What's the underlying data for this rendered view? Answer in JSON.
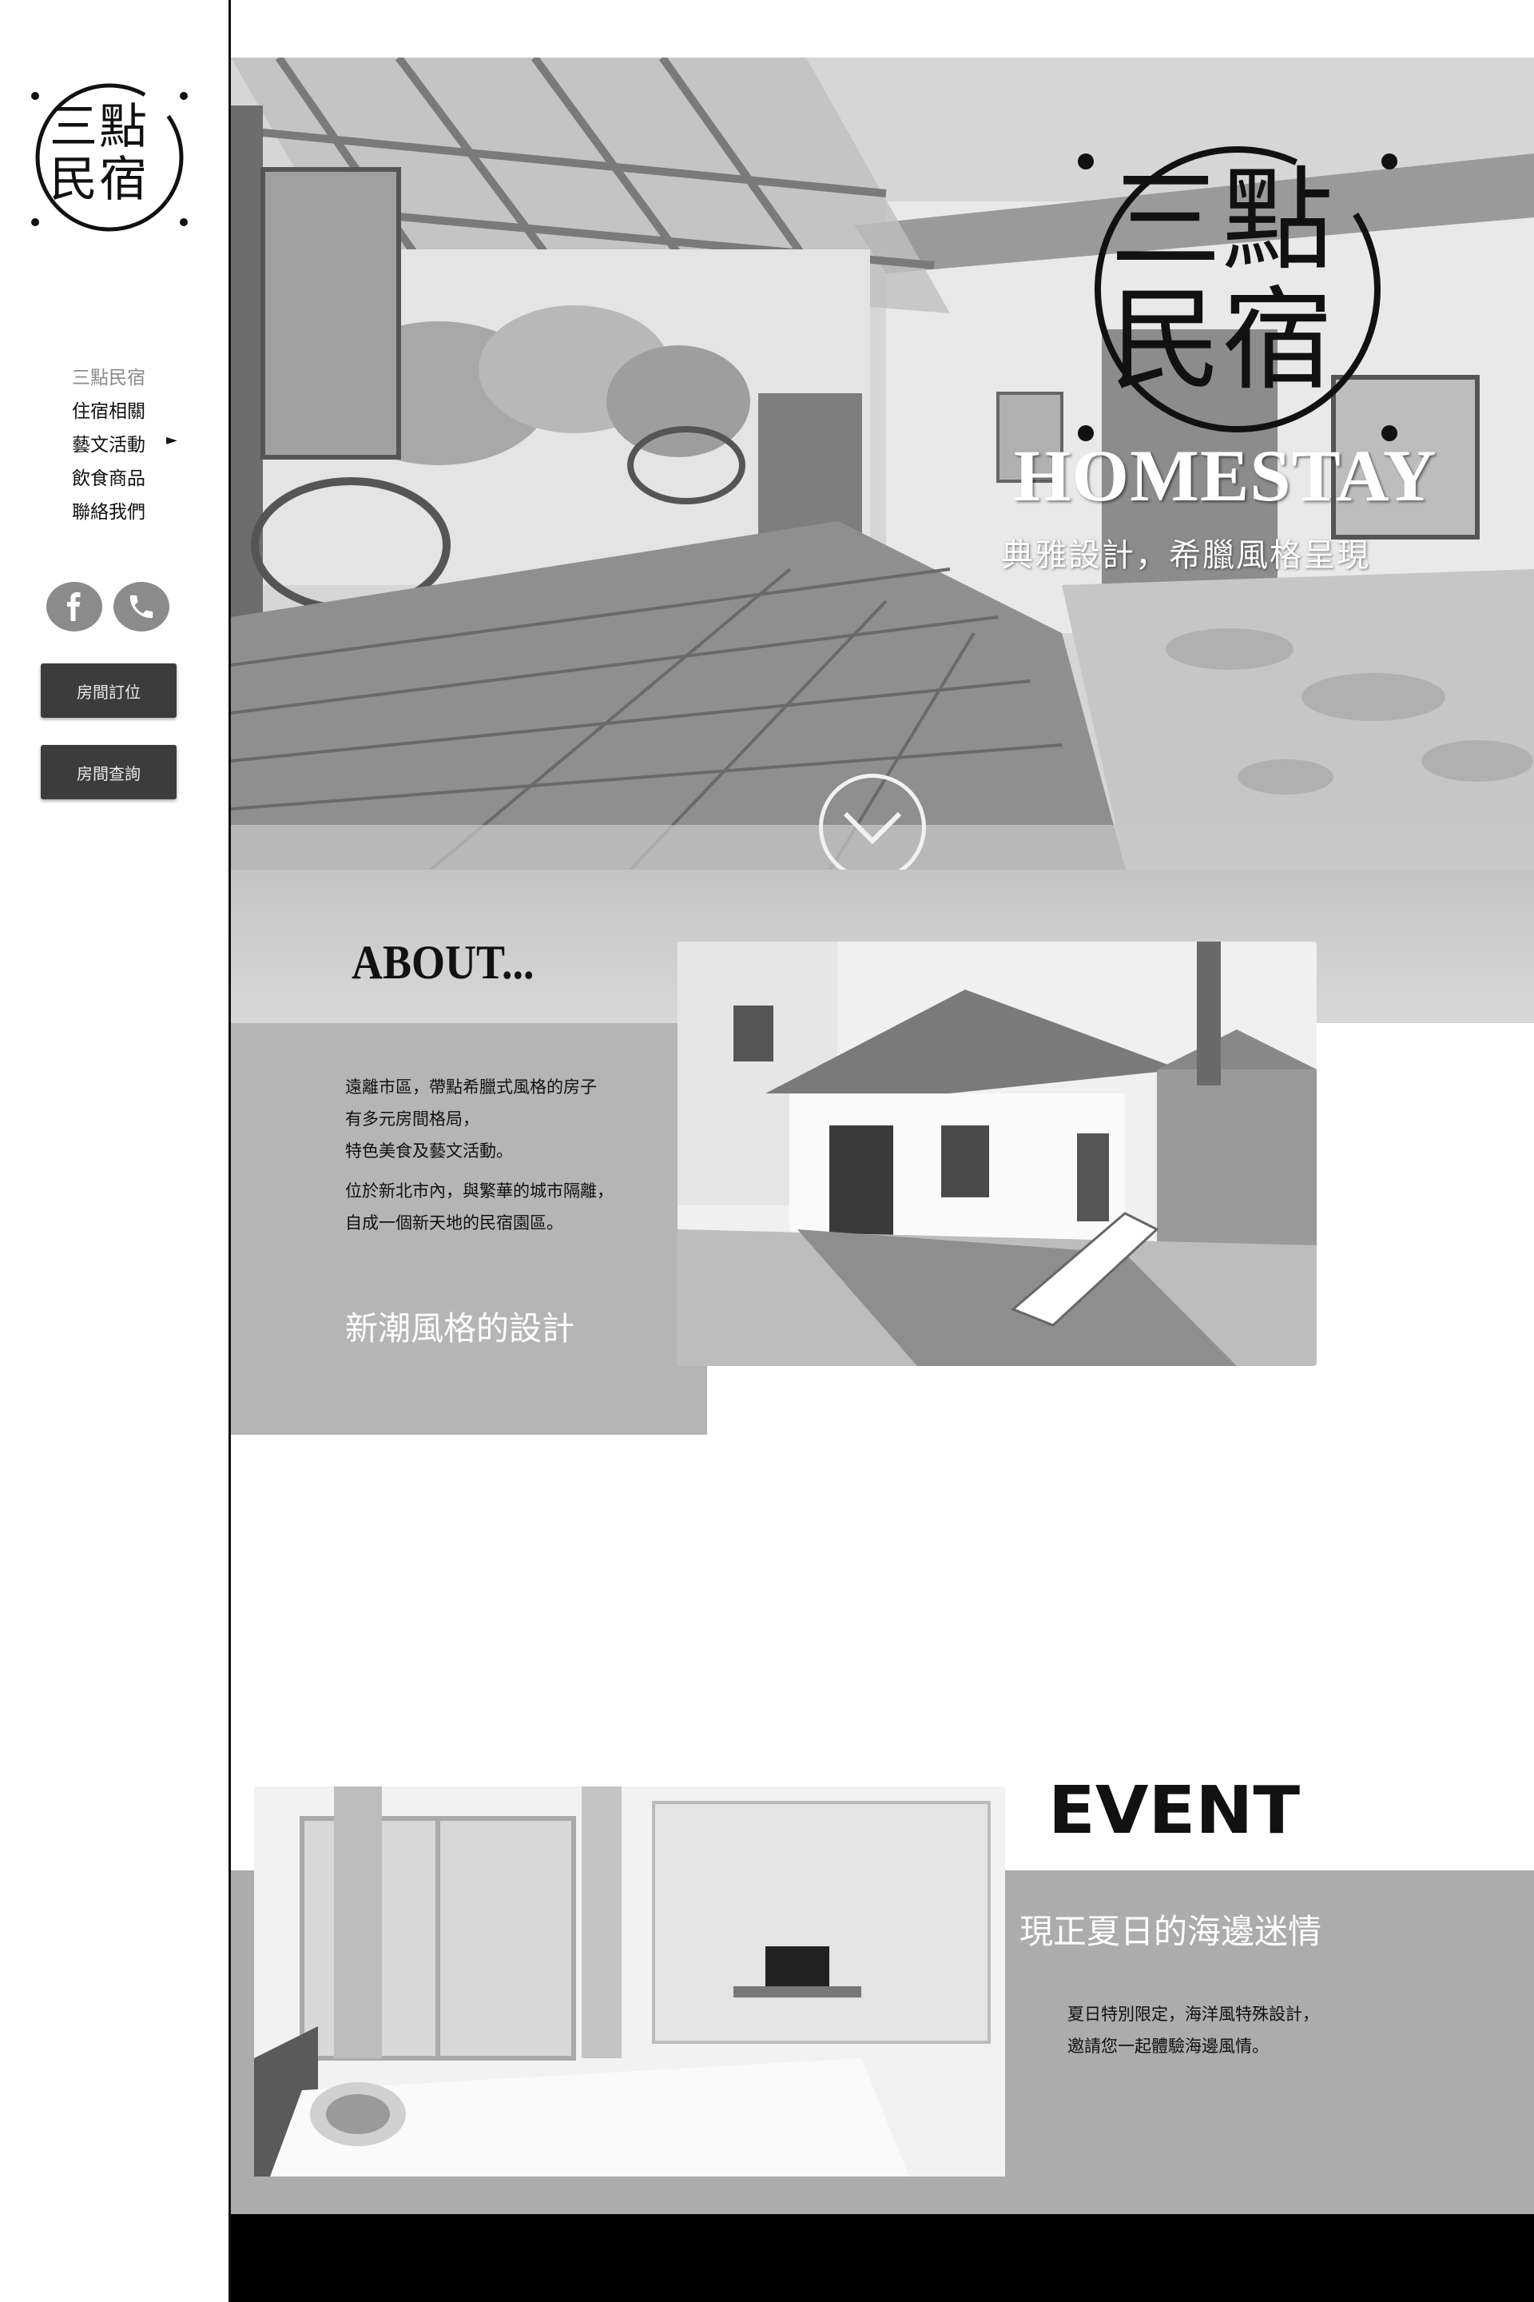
{
  "brand": {
    "logo_text": "三點民宿"
  },
  "sidebar": {
    "nav": [
      {
        "label": "三點民宿",
        "active": true
      },
      {
        "label": "住宿相關",
        "active": false
      },
      {
        "label": "藝文活動",
        "active": false
      },
      {
        "label": "飲食商品",
        "active": false
      },
      {
        "label": "聯絡我們",
        "active": false
      }
    ],
    "social": [
      {
        "icon": "facebook-icon",
        "glyph": "f"
      },
      {
        "icon": "phone-icon",
        "glyph": "✆"
      }
    ],
    "buttons": {
      "booking": "房間訂位",
      "inquiry": "房間查詢"
    }
  },
  "hero": {
    "logo_text": "三點民宿",
    "title": "HOMESTAY",
    "subtitle": "典雅設計，希臘風格呈現"
  },
  "about": {
    "title": "ABOUT...",
    "lines": [
      "遠離市區，帶點希臘式風格的房子",
      "有多元房間格局，",
      "特色美食及藝文活動。",
      "位於新北市內，與繁華的城市隔離，",
      "自成一個新天地的民宿園區。"
    ],
    "subtitle": "新潮風格的設計"
  },
  "event": {
    "title": "EVENT",
    "subtitle": "現正夏日的海邊迷情",
    "lines": [
      "夏日特別限定，海洋風特殊設計，",
      "邀請您一起體驗海邊風情。"
    ]
  },
  "colors": {
    "accent_dark": "#3c3c3c",
    "panel_gray": "#b5b5b5",
    "event_gray": "#acacac"
  }
}
